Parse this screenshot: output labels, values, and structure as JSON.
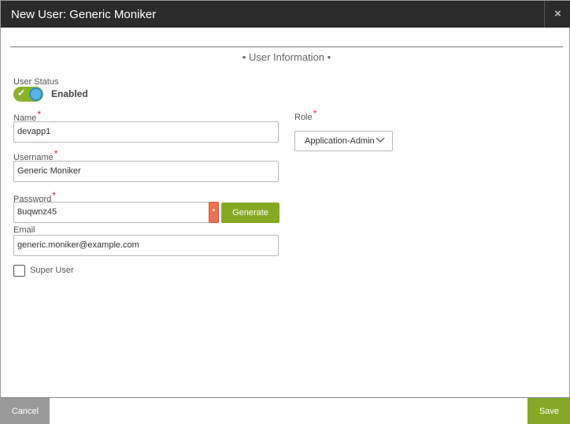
{
  "dialog": {
    "title": "New User: Generic Moniker",
    "close_icon": "×"
  },
  "section": {
    "heading": "• User Information •"
  },
  "user_status": {
    "label": "User Status",
    "state_text": "Enabled",
    "enabled": true,
    "check_glyph": "✔"
  },
  "fields": {
    "name": {
      "label": "Name",
      "required": "*",
      "value": "devapp1"
    },
    "username": {
      "label": "Username",
      "required": "*",
      "value": "Generic Moniker"
    },
    "password": {
      "label": "Password",
      "required": "*",
      "value": "8uqwnz45",
      "marker": "*"
    },
    "email": {
      "label": "Email",
      "value": "generic.moniker@example.com"
    },
    "super_user": {
      "label": "Super User",
      "checked": false
    },
    "role": {
      "label": "Role",
      "required": "*",
      "value": "Application-Admin"
    }
  },
  "buttons": {
    "generate": "Generate",
    "cancel": "Cancel",
    "save": "Save"
  },
  "colors": {
    "accent_green": "#86a925",
    "title_bar": "#2b2b2b",
    "required_red": "#e02020",
    "toggle_blue": "#5ab4e6",
    "password_marker": "#ec7153"
  },
  "icons": {
    "close": "close-icon",
    "check": "check-icon",
    "chevron": "chevron-down-icon"
  }
}
